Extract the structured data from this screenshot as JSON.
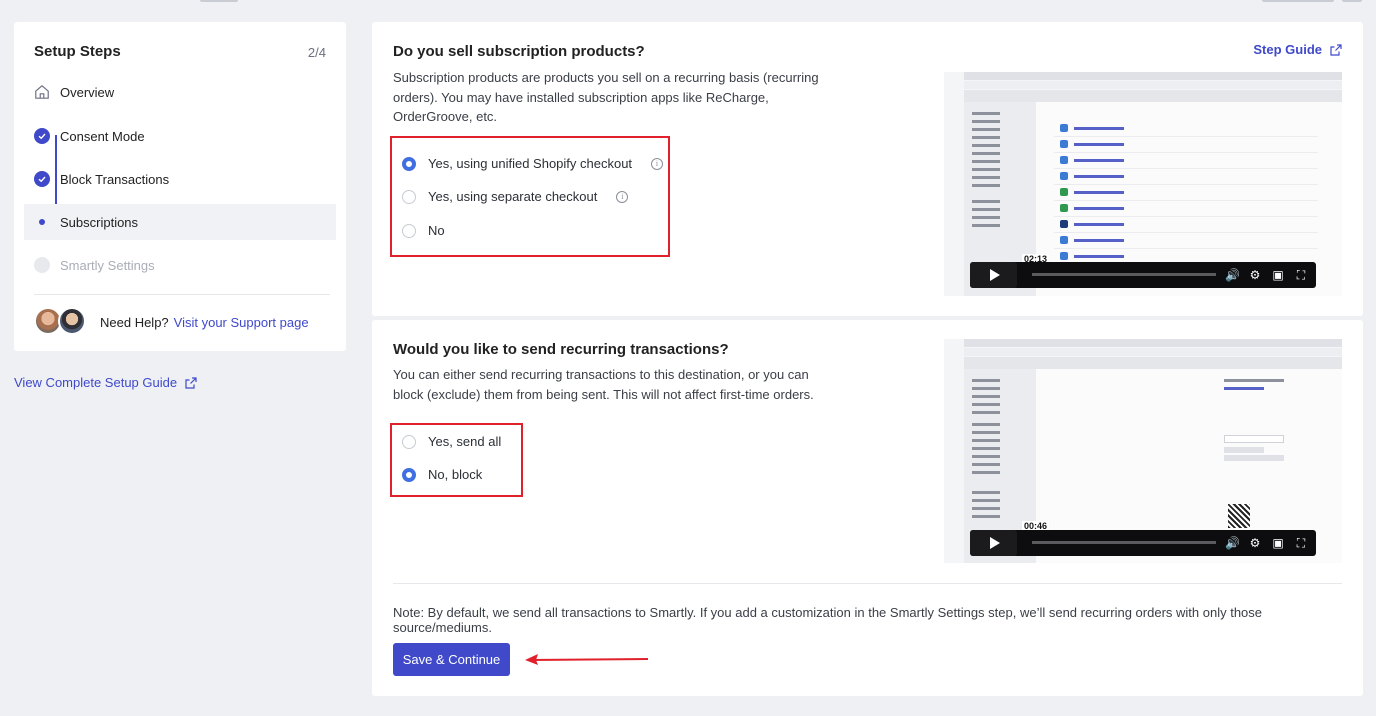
{
  "sidebar": {
    "title": "Setup Steps",
    "progress": "2/4",
    "steps": [
      {
        "label": "Overview",
        "state": "home"
      },
      {
        "label": "Consent Mode",
        "state": "done"
      },
      {
        "label": "Block Transactions",
        "state": "done"
      },
      {
        "label": "Subscriptions",
        "state": "active"
      },
      {
        "label": "Smartly Settings",
        "state": "disabled"
      }
    ],
    "help_text": "Need Help?",
    "help_link": "Visit your Support page",
    "guide_link": "View Complete Setup Guide"
  },
  "section1": {
    "title": "Do you sell subscription products?",
    "description": "Subscription products are products you sell on a recurring basis (recurring orders). You may have installed subscription apps like ReCharge, OrderGroove, etc.",
    "step_guide": "Step Guide",
    "options": [
      {
        "label": "Yes, using unified Shopify checkout",
        "selected": true,
        "info": true
      },
      {
        "label": "Yes, using separate checkout",
        "selected": false,
        "info": true
      },
      {
        "label": "No",
        "selected": false,
        "info": false
      }
    ],
    "video_time": "02:13"
  },
  "section2": {
    "title": "Would you like to send recurring transactions?",
    "description": "You can either send recurring transactions to this destination, or you can block (exclude) them from being sent. This will not affect first-time orders.",
    "options": [
      {
        "label": "Yes, send all",
        "selected": false
      },
      {
        "label": "No, block",
        "selected": true
      }
    ],
    "video_time": "00:46",
    "note": "Note: By default, we send all transactions to Smartly. If you add a customization in the Smartly Settings step, we’ll send recurring orders with only those source/mediums.",
    "save_label": "Save & Continue"
  },
  "colors": {
    "accent": "#3f49c9",
    "highlight": "#e0212b",
    "radio": "#3f6fe0"
  }
}
